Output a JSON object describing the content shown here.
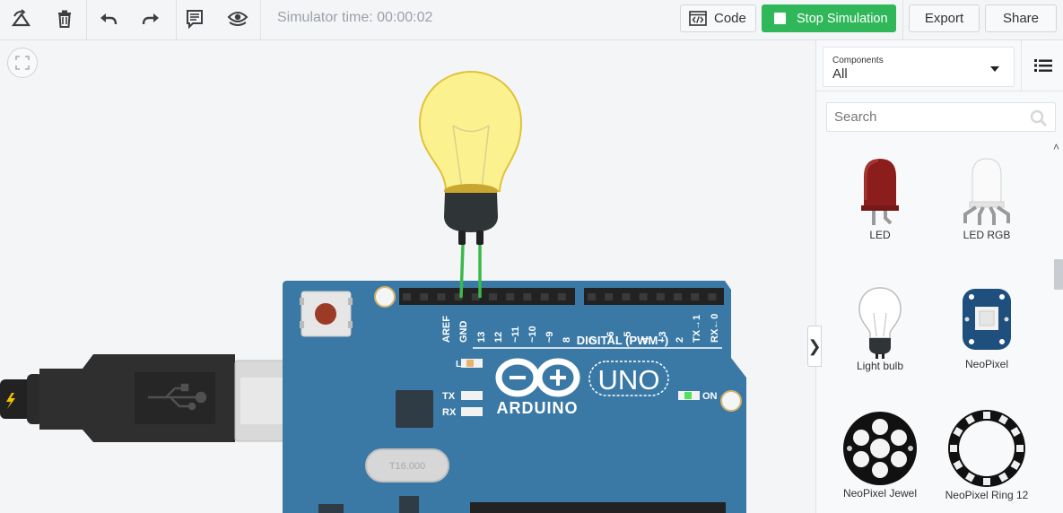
{
  "toolbar": {
    "sim_time": "Simulator time: 00:00:02",
    "code_label": "Code",
    "stop_label": "Stop Simulation",
    "export_label": "Export",
    "share_label": "Share"
  },
  "colors": {
    "stop_green": "#2fb75a",
    "arduino_blue": "#3a79a5",
    "bulb_lit": "#fbf28f",
    "wire_green": "#3cb94a"
  },
  "board": {
    "brand": "ARDUINO",
    "model": "UNO",
    "digital_label": "DIGITAL (PWM~)",
    "on_label": "ON",
    "led_l": "L",
    "tx": "TX",
    "rx": "RX",
    "crystal": "T16.000",
    "pin_labels": [
      "AREF",
      "GND",
      "13",
      "12",
      "~11",
      "~10",
      "~9",
      "8",
      "7",
      "~6",
      "~5",
      "4",
      "~3",
      "2",
      "TX→1",
      "RX←0"
    ]
  },
  "panel": {
    "filter_label": "Components",
    "filter_value": "All",
    "search_placeholder": "Search",
    "components": [
      {
        "name": "LED",
        "icon": "led-icon"
      },
      {
        "name": "LED RGB",
        "icon": "led-rgb-icon"
      },
      {
        "name": "Light bulb",
        "icon": "light-bulb-icon"
      },
      {
        "name": "NeoPixel",
        "icon": "neopixel-icon"
      },
      {
        "name": "NeoPixel Jewel",
        "icon": "neopixel-jewel-icon"
      },
      {
        "name": "NeoPixel Ring 12",
        "icon": "neopixel-ring-icon"
      }
    ]
  }
}
